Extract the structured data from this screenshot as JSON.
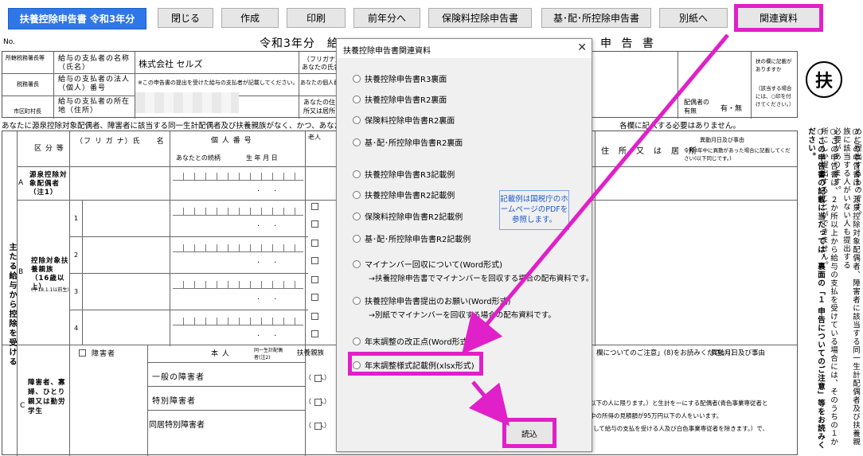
{
  "toolbar": {
    "title": "扶養控除申告書 令和3年分",
    "buttons": [
      "閉じる",
      "作成",
      "印刷",
      "前年分へ",
      "保険料控除申告書",
      "基･配･所控除申告書",
      "別紙へ",
      "関連資料"
    ]
  },
  "form": {
    "no_label": "No.",
    "title_left": "令和3年分　給",
    "title_right": "申 告 書",
    "row_labels": {
      "tax_office": "所轄税務署長等",
      "payer_name": "給与の支払者の名称（氏名）",
      "payer_number": "給与の支払者の法人（個人）番号",
      "payer_address": "給与の支払者の所在地（住所）",
      "tax_office_head": "税務署長",
      "city_head": "市区町村長",
      "note_small": "※この申告書の提出を受けた給与の支払者が記載してください。",
      "furigana": "（フリガナ）",
      "your_name": "あなたの氏名",
      "your_person_no": "あなたの個人番号",
      "your_address": "あなたの住所又は居所",
      "spouse_exist": "配偶者の有無",
      "spouse_yes_no": "有・無",
      "side_note_1": "扶の欄に記載がありますか",
      "side_note_2": "（該当する場合には、○印を付けてください。）"
    },
    "company_name": "株式会社 セルズ",
    "notice": "あなたに源泉控除対象配偶者、障害者に該当する同一生計配偶者及び扶養親族がなく、かつ、あなた自身",
    "notice_tail": "各欄に記入する必要はありません。",
    "grid": {
      "col_category": "区 分 等",
      "col_name": "（フ リ ガ ナ）氏　　名",
      "col_number": "個 人 番 号",
      "col_relation": "あなたとの続柄",
      "col_birth": "生 年 月 日",
      "col_elder": "老人",
      "col_address": "住　所　又　は　居　所",
      "col_change": "異動月日及び事由",
      "col_change_note": "令和3年中に異動があった場合に記載してください(以下同じです。)",
      "row_a": "源泉控除対象配偶者（注1）",
      "row_a_letter": "A",
      "row_b": "控除対象扶養親族（16歳以上）",
      "row_b_sub": "(平18.1.1以前生)",
      "row_b_letter": "B",
      "row_nums": [
        "1",
        "2",
        "3",
        "4"
      ],
      "main_vertical": "主たる給与から控除を受ける",
      "row_c": "障害者、寡婦、ひとり親又は勤労学生",
      "row_c_letter": "C",
      "disabled_label": "障害者",
      "disabled_types": [
        "一般の障害者",
        "特別障害者",
        "同居特別障害者"
      ],
      "col_self": "本 人",
      "col_spouse": "同一生計配偶者(注2)",
      "col_dependents": "扶養親族",
      "people_unit": "（　人）",
      "change_head": "異動月日及び事由",
      "note_c": "欄についてのご注意」(8)をお読みください。）",
      "foot_1": "以下の人に限ります。）と生計を一にする配偶者(青色事業専従者と",
      "foot_2": "中の所得の見積額が95万円以下の人をいいます。",
      "foot_3": "して給与の支払を受ける人及び白色事業専従者を除きます。）で、"
    },
    "side_badge": "扶",
    "side_text": [
      "○この申告書は、あなたの給与について扶養控除、障害者控除などの控除を受けるために提出するものです。",
      "○この申告書は、源泉控除対象配偶者、障害者に該当する同一生計配偶者及び扶養親族に該当する人がいない人も提出する",
      "必要があります。",
      "○この申告書は、２か所以上から給与の支払を受けている場合には、そのうちの１か所にしか提出することができません。",
      "○この申告書の記載に当たっては、裏面の「１ 申告についてのご注意」等をお読みください。"
    ]
  },
  "dialog": {
    "title": "扶養控除申告書関連資料",
    "close": "✕",
    "options": [
      "扶養控除申告書R3裏面",
      "扶養控除申告書R2裏面",
      "保険料控除申告書R2裏面",
      "基･配･所控除申告書R2裏面",
      "扶養控除申告書R3記載例",
      "扶養控除申告書R2記載例",
      "保険料控除申告書R2記載例",
      "基･配･所控除申告書R2記載例",
      "マイナンバー回収について(Word形式)",
      "扶養控除申告書提出のお願い(Word形式)",
      "年末調整の改正点(Word形式)",
      "年末調整様式記載例(xlsx形式)"
    ],
    "sub_notes": [
      "→扶養控除申告書でマイナンバーを回収する場合の配布資料です。",
      "→別紙でマイナンバーを回収する場合の配布資料です。"
    ],
    "info": "記載例は国税庁のホームページのPDFを参照します。",
    "read_button": "読込"
  },
  "colors": {
    "highlight": "#e020c8",
    "title_blue": "#2f77e8",
    "info_blue": "#1a58c8"
  }
}
